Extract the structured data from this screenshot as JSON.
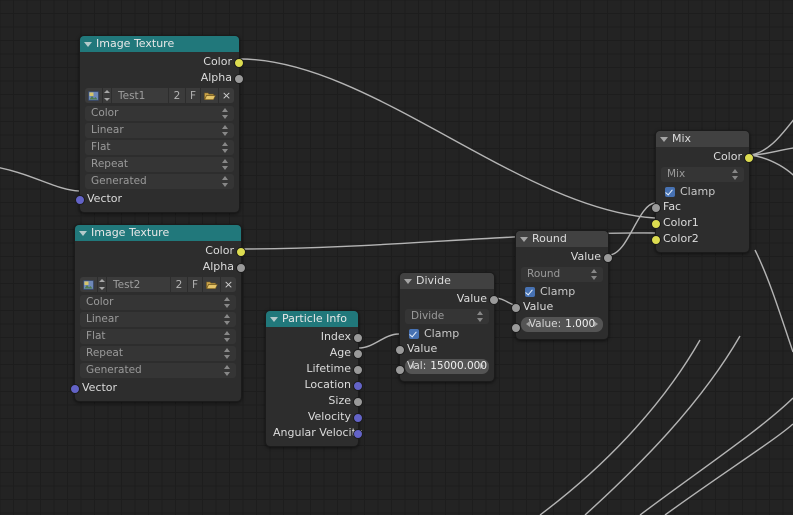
{
  "app": {
    "editor": "Blender Shader Node Editor",
    "background_color": "#232323",
    "grid_line_color": "#1d1d1d",
    "noodle_color": "#b4b4b4"
  },
  "palette": {
    "header_teal": "#21787b",
    "header_gray": "#414141",
    "node_body": "#2d2d2d",
    "socket_yellow": "#dcdc50",
    "socket_gray": "#9a9a9a",
    "socket_vector": "#6363c7",
    "checkbox_blue": "#4772b3"
  },
  "nodes": [
    {
      "id": "image-texture-1",
      "title": "Image Texture",
      "header_style": "teal",
      "outputs": [
        {
          "label": "Color",
          "socket": "yellow"
        },
        {
          "label": "Alpha",
          "socket": "gray"
        }
      ],
      "image_row": {
        "icon": "image-datablock-icon",
        "name": "Test1",
        "users": "2",
        "fake_user": "F",
        "open_icon": "folder-open-icon",
        "unlink_icon": "x-icon"
      },
      "dropdowns": [
        "Color",
        "Linear",
        "Flat",
        "Repeat",
        "Generated"
      ],
      "inputs": [
        {
          "label": "Vector",
          "socket": "purple"
        }
      ]
    },
    {
      "id": "image-texture-2",
      "title": "Image Texture",
      "header_style": "teal",
      "outputs": [
        {
          "label": "Color",
          "socket": "yellow"
        },
        {
          "label": "Alpha",
          "socket": "gray"
        }
      ],
      "image_row": {
        "icon": "image-datablock-icon",
        "name": "Test2",
        "users": "2",
        "fake_user": "F",
        "open_icon": "folder-open-icon",
        "unlink_icon": "x-icon"
      },
      "dropdowns": [
        "Color",
        "Linear",
        "Flat",
        "Repeat",
        "Generated"
      ],
      "inputs": [
        {
          "label": "Vector",
          "socket": "purple"
        }
      ]
    },
    {
      "id": "particle-info",
      "title": "Particle Info",
      "header_style": "teal",
      "outputs": [
        {
          "label": "Index",
          "socket": "gray"
        },
        {
          "label": "Age",
          "socket": "gray"
        },
        {
          "label": "Lifetime",
          "socket": "gray"
        },
        {
          "label": "Location",
          "socket": "purple"
        },
        {
          "label": "Size",
          "socket": "gray"
        },
        {
          "label": "Velocity",
          "socket": "purple"
        },
        {
          "label": "Angular Velocity",
          "socket": "purple"
        }
      ]
    },
    {
      "id": "divide",
      "title": "Divide",
      "header_style": "gray",
      "outputs": [
        {
          "label": "Value",
          "socket": "gray"
        }
      ],
      "operation": "Divide",
      "clamp": {
        "label": "Clamp",
        "checked": true
      },
      "inputs": [
        {
          "label": "Value",
          "socket": "gray"
        },
        {
          "label": "Val:",
          "value": "15000.000",
          "socket": "gray",
          "is_value_field": true
        }
      ]
    },
    {
      "id": "round",
      "title": "Round",
      "header_style": "gray",
      "outputs": [
        {
          "label": "Value",
          "socket": "gray"
        }
      ],
      "operation": "Round",
      "clamp": {
        "label": "Clamp",
        "checked": true
      },
      "inputs": [
        {
          "label": "Value",
          "socket": "gray"
        },
        {
          "label": "Value:",
          "value": "1.000",
          "socket": "gray",
          "is_value_field": true
        }
      ]
    },
    {
      "id": "mix",
      "title": "Mix",
      "header_style": "gray",
      "outputs": [
        {
          "label": "Color",
          "socket": "yellow"
        }
      ],
      "operation": "Mix",
      "clamp": {
        "label": "Clamp",
        "checked": true
      },
      "inputs": [
        {
          "label": "Fac",
          "socket": "gray"
        },
        {
          "label": "Color1",
          "socket": "yellow"
        },
        {
          "label": "Color2",
          "socket": "yellow"
        }
      ]
    }
  ],
  "links": [
    {
      "from": "image-texture-1.Color",
      "to": "mix.Color1"
    },
    {
      "from": "image-texture-2.Color",
      "to": "mix.Color2"
    },
    {
      "from": "particle-info.Age",
      "to": "divide.Value"
    },
    {
      "from": "divide.Value",
      "to": "round.Value"
    },
    {
      "from": "round.Value",
      "to": "mix.Fac"
    },
    {
      "from": "offscreen-left",
      "to": "image-texture-1.Vector"
    },
    {
      "from": "mix.Color",
      "to": "offscreen-right"
    }
  ]
}
